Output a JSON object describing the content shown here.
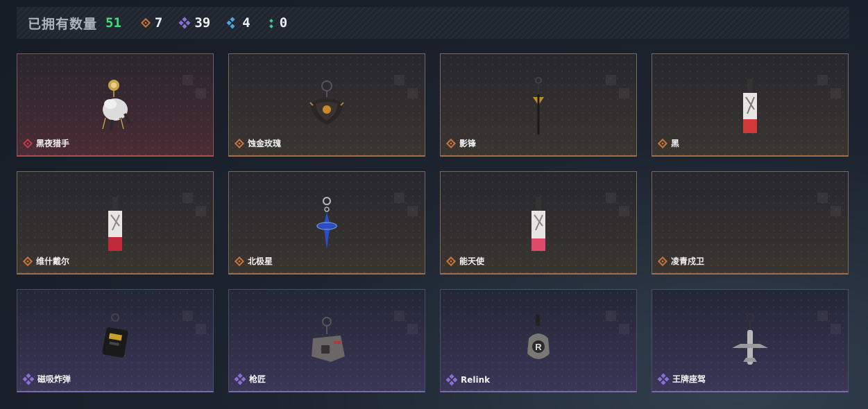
{
  "header": {
    "owned_label": "已拥有数量",
    "owned_count": "51",
    "stats": [
      {
        "rarity": "orange",
        "count": "7"
      },
      {
        "rarity": "purple",
        "count": "39"
      },
      {
        "rarity": "blue",
        "count": "4"
      },
      {
        "rarity": "green",
        "count": "0"
      }
    ]
  },
  "colors": {
    "owned_count": "#3ee07a",
    "orange": "#c8743a",
    "purple": "#8b6fd6",
    "blue": "#4aa8e0",
    "green": "#3ecf8e",
    "red": "#c23a48"
  },
  "items": [
    {
      "name": "黑夜猎手",
      "rarity": "red",
      "icon": "white-wolf-gold-flower-charm-icon"
    },
    {
      "name": "蚀金玫瑰",
      "rarity": "orange",
      "icon": "black-gold-rose-charm-icon"
    },
    {
      "name": "影锋",
      "rarity": "orange",
      "icon": "dagger-charm-icon"
    },
    {
      "name": "黑",
      "rarity": "orange",
      "icon": "card-keychain-charm-icon"
    },
    {
      "name": "维什戴尔",
      "rarity": "orange",
      "icon": "card-keychain-charm-icon"
    },
    {
      "name": "北极星",
      "rarity": "orange",
      "icon": "blue-star-charm-icon"
    },
    {
      "name": "能天使",
      "rarity": "orange",
      "icon": "card-keychain-charm-icon"
    },
    {
      "name": "凌青戍卫",
      "rarity": "orange",
      "icon": "empty-slot-icon"
    },
    {
      "name": "磁吸炸弹",
      "rarity": "purple",
      "icon": "bomb-charm-icon"
    },
    {
      "name": "枪匠",
      "rarity": "purple",
      "icon": "gunsmith-badge-charm-icon"
    },
    {
      "name": "Relink",
      "rarity": "purple",
      "icon": "r-emblem-charm-icon"
    },
    {
      "name": "王牌座驾",
      "rarity": "purple",
      "icon": "jet-plane-charm-icon"
    }
  ]
}
